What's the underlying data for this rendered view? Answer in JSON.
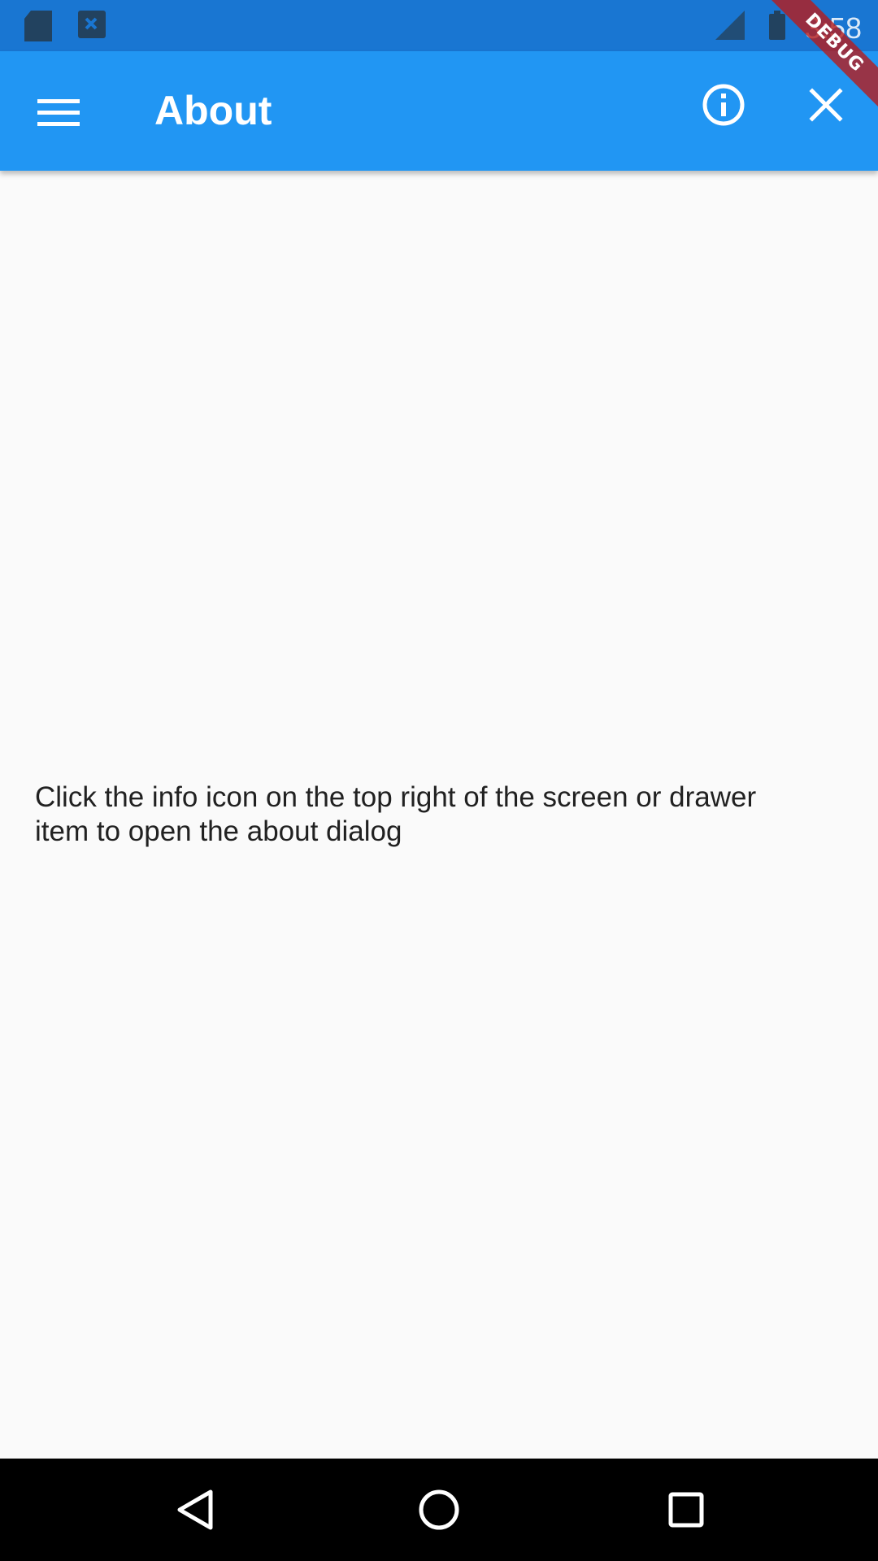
{
  "status_bar": {
    "time": "3:58",
    "icons": [
      "sd-card-icon",
      "notification-icon",
      "signal-icon",
      "battery-icon"
    ]
  },
  "debug_banner": {
    "label": "DEBUG"
  },
  "app_bar": {
    "title": "About",
    "background": "#2196f3",
    "icons": [
      "menu-icon",
      "info-icon",
      "close-icon"
    ]
  },
  "content": {
    "message": "Click the info icon on the top right of the screen or drawer item to open the about dialog"
  },
  "nav_bar": {
    "icons": [
      "back-icon",
      "home-icon",
      "recents-icon"
    ]
  }
}
